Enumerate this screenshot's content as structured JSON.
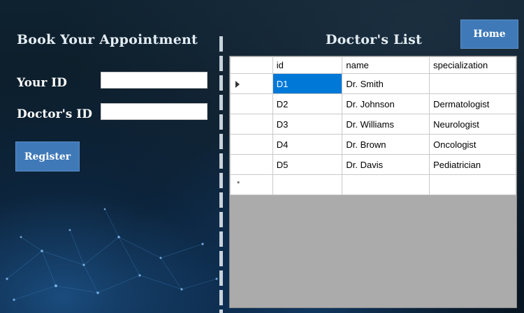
{
  "left_panel": {
    "title": "Book Your Appointment",
    "your_id_label": "Your ID",
    "your_id_value": "",
    "doctor_id_label": "Doctor's ID",
    "doctor_id_value": "",
    "register_label": "Register"
  },
  "right_panel": {
    "title": "Doctor's List",
    "home_label": "Home"
  },
  "grid": {
    "columns": [
      "id",
      "name",
      "specialization"
    ],
    "rows": [
      {
        "id": "D1",
        "name": "Dr. Smith",
        "specialization": ""
      },
      {
        "id": "D2",
        "name": "Dr. Johnson",
        "specialization": "Dermatologist"
      },
      {
        "id": "D3",
        "name": "Dr. Williams",
        "specialization": "Neurologist"
      },
      {
        "id": "D4",
        "name": "Dr. Brown",
        "specialization": "Oncologist"
      },
      {
        "id": "D5",
        "name": "Dr. Davis",
        "specialization": "Pediatrician"
      }
    ],
    "new_row_marker": "*"
  },
  "colors": {
    "button": "#3f79b8",
    "selection": "#0078d7",
    "grid_background": "#ababab"
  },
  "icons": {
    "current_row": "row-pointer-icon",
    "new_row": "new-row-star-icon"
  }
}
